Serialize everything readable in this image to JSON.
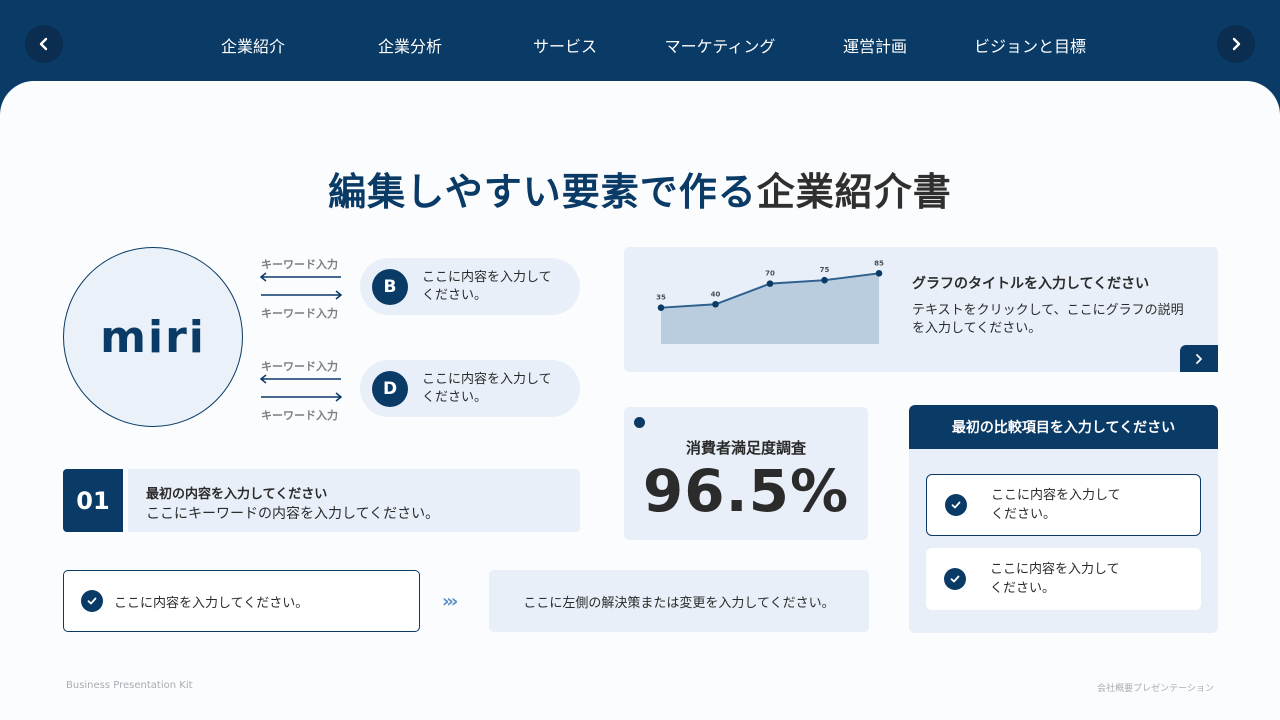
{
  "nav": {
    "items": [
      {
        "label": "企業紹介"
      },
      {
        "label": "企業分析"
      },
      {
        "label": "サービス"
      },
      {
        "label": "マーケティング"
      },
      {
        "label": "運営計画"
      },
      {
        "label": "ビジョンと目標"
      }
    ],
    "prev_icon": "chevron-left-icon",
    "next_icon": "chevron-right-icon"
  },
  "title": {
    "accent": "編集しやすい要素で作る",
    "rest": "企業紹介書"
  },
  "logo": {
    "text": "miri"
  },
  "flows": [
    {
      "keyword_top": "キーワード入力",
      "keyword_bottom": "キーワード入力",
      "badge": "B",
      "text": "ここに内容を入力して\nください。"
    },
    {
      "keyword_top": "キーワード入力",
      "keyword_bottom": "キーワード入力",
      "badge": "D",
      "text": "ここに内容を入力して\nください。"
    }
  ],
  "step": {
    "number": "01",
    "title": "最初の内容を入力してください",
    "desc": "ここにキーワードの内容を入力してください。"
  },
  "problem": {
    "text": "ここに内容を入力してください。"
  },
  "solution": {
    "text": "ここに左側の解決策または変更を入力してください。"
  },
  "graph": {
    "title": "グラフのタイトルを入力してください",
    "desc": "テキストをクリックして、ここにグラフの説明を入力してください。",
    "more_icon": "chevron-right-icon"
  },
  "chart_data": {
    "type": "area",
    "x": [
      1,
      2,
      3,
      4,
      5
    ],
    "values": [
      35,
      40,
      70,
      75,
      85
    ],
    "data_labels": [
      "35",
      "40",
      "70",
      "75",
      "85"
    ],
    "title": "",
    "xlabel": "",
    "ylabel": "",
    "grid": false,
    "colors": {
      "line": "#2d5f8f",
      "fill": "#b9cddf",
      "marker": "#0a3a66"
    }
  },
  "stat": {
    "label": "消費者満足度調査",
    "value": "96.5%"
  },
  "comparison": {
    "header": "最初の比較項目を入力してください",
    "items": [
      {
        "text": "ここに内容を入力して\nください。",
        "selected": true
      },
      {
        "text": "ここに内容を入力して\nください。",
        "selected": false
      }
    ]
  },
  "footer": {
    "left": "Business Presentation Kit",
    "right": "会社概要プレゼンテーション"
  },
  "colors": {
    "primary": "#0a3a66",
    "panel": "#e8eff8",
    "background": "#fbfcfd",
    "accent_chevrons": "#5b8fc9"
  }
}
